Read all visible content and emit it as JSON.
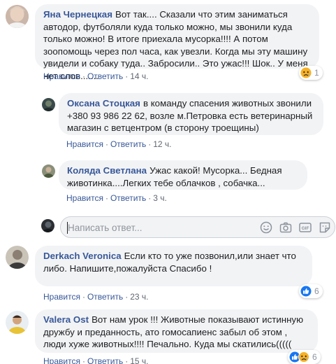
{
  "actions": {
    "like": "Нравится",
    "reply": "Ответить",
    "separator": "·"
  },
  "comments": [
    {
      "author": "Яна Чернецкая",
      "text": "Вот так.... Сказали что этим заниматься автодор, футболяли куда только можно, мы звонили куда только можно! В итоге приехала мусорка!!!! А потом зоопомощь через пол часа, как увезли. Когда мы эту машину увидели и собаку туда.. Забросили.. Это ужас!!! Шок.. У меня нет слов.......",
      "time": "14 ч.",
      "reaction": {
        "icon": "sad-reaction-icon",
        "count": "1"
      }
    },
    {
      "author": "Оксана Стоцкая",
      "text": "в команду спасения животных звонили +380 93 986 22 62, возле м.Петровка есть ветеринарный магазин с ветцентром (в сторону троещины)",
      "time": "12 ч."
    },
    {
      "author": "Коляда Светлана",
      "text": "Ужас какой! Мусорка... Бедная животинка....Легких тебе облачков , собачка...",
      "time": "3 ч."
    },
    {
      "author": "Derkach Veronica",
      "text": "Если кто то уже позвонил,или знает что либо. Напишите,пожалуйста Спасибо !",
      "time": "23 ч.",
      "reaction": {
        "icon": "like-reaction-icon",
        "count": "6"
      }
    },
    {
      "author": "Valera Ost",
      "text": "Вот нам урок !!! Животные показывают истинную дружбу и преданность, ато гомосапиенс забыл об этом , люди хуже животных!!!! Печально. Куда мы скатились(((((",
      "time": "15 ч.",
      "reaction": {
        "icons": [
          "like-reaction-icon",
          "sad-reaction-icon"
        ],
        "count": "6"
      }
    }
  ],
  "reply_box": {
    "placeholder": "Написать ответ...",
    "icons": [
      "emoji-icon",
      "camera-icon",
      "gif-icon",
      "sticker-icon"
    ]
  },
  "colors": {
    "link": "#385898",
    "bubble": "#f2f3f5",
    "like_blue": "#1877f2",
    "sad_yellow": "#f7b125"
  }
}
